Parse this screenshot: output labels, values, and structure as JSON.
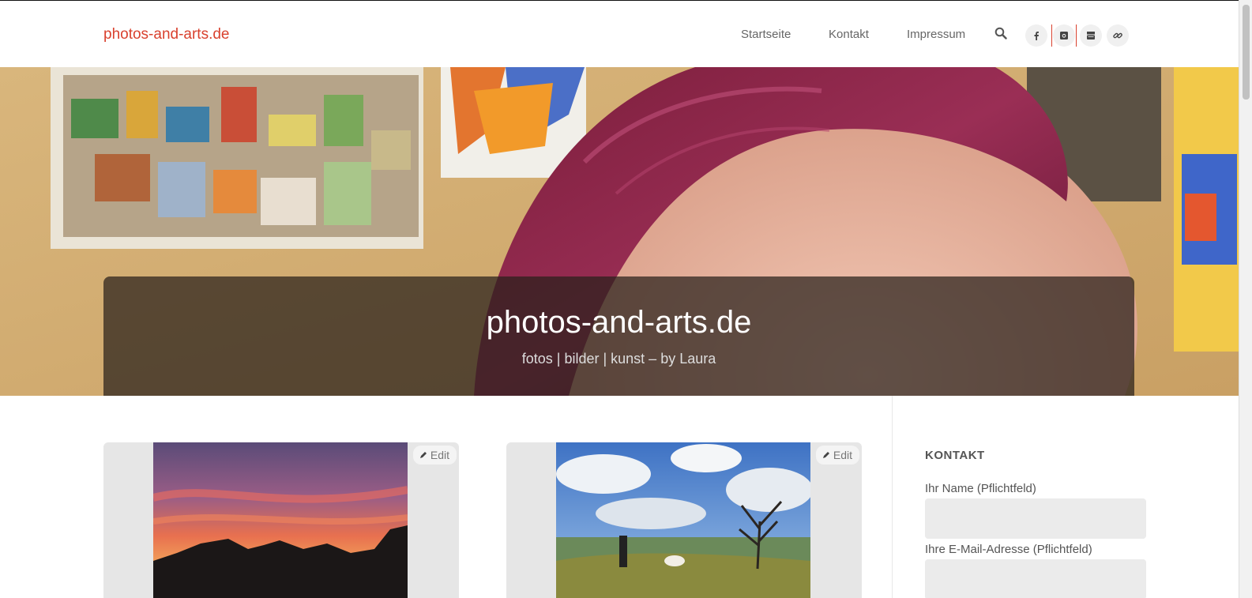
{
  "header": {
    "brand": "photos-and-arts.de",
    "nav": [
      {
        "label": "Startseite"
      },
      {
        "label": "Kontakt"
      },
      {
        "label": "Impressum"
      }
    ],
    "icons": [
      "search-icon",
      "facebook-icon",
      "instagram-icon",
      "youtube-icon",
      "link-icon"
    ]
  },
  "hero": {
    "title": "photos-and-arts.de",
    "subtitle": "fotos | bilder | kunst – by Laura"
  },
  "posts": [
    {
      "edit_label": "Edit",
      "image": "sunset-photo"
    },
    {
      "edit_label": "Edit",
      "image": "landscape-photo"
    }
  ],
  "sidebar": {
    "widget_title": "KONTAKT",
    "fields": [
      {
        "label": "Ihr Name (Pflichtfeld)",
        "value": ""
      },
      {
        "label": "Ihre E-Mail-Adresse (Pflichtfeld)",
        "value": ""
      }
    ]
  },
  "colors": {
    "accent": "#d9412e",
    "hero_overlay": "#28201a"
  }
}
